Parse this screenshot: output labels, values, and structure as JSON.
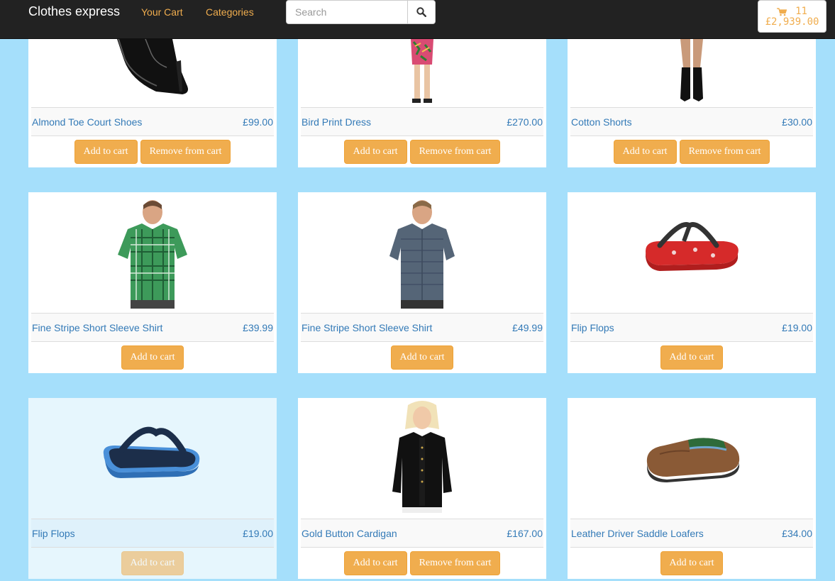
{
  "navbar": {
    "brand": "Clothes express",
    "links": [
      "Your Cart",
      "Categories"
    ],
    "search_placeholder": "Search",
    "cart_count": "11",
    "cart_total": "£2,939.00"
  },
  "products": [
    {
      "name": "Almond Toe Court Shoes",
      "price": "£99.00",
      "image": "court-shoes-image",
      "buttons": [
        "Add to cart",
        "Remove from cart"
      ]
    },
    {
      "name": "Bird Print Dress",
      "price": "£270.00",
      "image": "dress-image",
      "buttons": [
        "Add to cart",
        "Remove from cart"
      ]
    },
    {
      "name": "Cotton Shorts",
      "price": "£30.00",
      "image": "shorts-image",
      "buttons": [
        "Add to cart",
        "Remove from cart"
      ]
    },
    {
      "name": "Fine Stripe Short Sleeve Shirt",
      "price": "£39.99",
      "image": "green-shirt-image",
      "buttons": [
        "Add to cart"
      ]
    },
    {
      "name": "Fine Stripe Short Sleeve Shirt",
      "price": "£49.99",
      "image": "grey-shirt-image",
      "buttons": [
        "Add to cart"
      ]
    },
    {
      "name": "Flip Flops",
      "price": "£19.00",
      "image": "red-flip-flops-image",
      "buttons": [
        "Add to cart"
      ]
    },
    {
      "name": "Flip Flops",
      "price": "£19.00",
      "image": "blue-flip-flops-image",
      "buttons": [
        "Add to cart"
      ]
    },
    {
      "name": "Gold Button Cardigan",
      "price": "£167.00",
      "image": "cardigan-image",
      "buttons": [
        "Add to cart",
        "Remove from cart"
      ]
    },
    {
      "name": "Leather Driver Saddle Loafers",
      "price": "£34.00",
      "image": "loafers-image",
      "buttons": [
        "Add to cart"
      ]
    }
  ],
  "colors": {
    "background": "#a5dffb",
    "navbar": "#222222",
    "accent": "#f0ad4e",
    "link": "#337ab7"
  }
}
